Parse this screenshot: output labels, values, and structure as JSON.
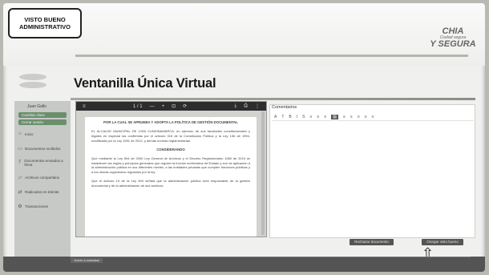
{
  "stamp": {
    "line1": "VISTO BUENO",
    "line2": "ADMINISTRATIVO"
  },
  "brand": {
    "right_top": "CHIA",
    "right_small": "Ciudad segura",
    "right_bottom": "Y SEGURA"
  },
  "page": {
    "title": "Ventanilla Única Virtual"
  },
  "sidebar": {
    "user": "Juan Gallo",
    "buttons": [
      "Cambiar clave",
      "Cerrar sesión"
    ],
    "items": [
      {
        "icon": "home-icon",
        "label": "Inicio"
      },
      {
        "icon": "document-icon",
        "label": "Documentos recibidos"
      },
      {
        "icon": "upload-icon",
        "label": "Documentos enviados a firma"
      },
      {
        "icon": "folder-icon",
        "label": "Archivos compartidos"
      },
      {
        "icon": "sync-icon",
        "label": "Radicados en trámite"
      },
      {
        "icon": "settings-icon",
        "label": "Transacciones"
      }
    ]
  },
  "viewer": {
    "menu_icon": "≡",
    "page_indicator": "1 / 1",
    "zoom_out": "—",
    "zoom_in": "+",
    "fit_icon": "⊡",
    "rotate_icon": "⟳",
    "download_icon": "⤓",
    "print_icon": "⎙",
    "more_icon": "⋮",
    "doc_heading": "POR LA CUAL SE APRUEBA Y ADOPTA LA POLÍTICA DE GESTIÓN DOCUMENTAL",
    "doc_para1": "EL ALCALDE MUNICIPAL DE CHÍA CUNDINAMARCA, en ejercicio de sus facultades constitucionales y legales en especial las conferidas por el artículo 315 de la Constitución Política y la Ley 136 de 1994, modificada por la Ley 1551 de 2012, y demás normas reglamentarias.",
    "doc_section": "CONSIDERANDO",
    "doc_para2": "Que mediante la Ley 594 de 2000 Ley General de Archivos y el Decreto Reglamentario 1080 de 2015 se establecen las reglas y principios generales que regulan la función archivística del Estado y son de aplicación a la administración pública en sus diferentes niveles, a las entidades privadas que cumplen funciones públicas y a los demás organismos regulados por la ley.",
    "doc_para3": "Que el artículo 19 de la Ley 594 señala que la administración pública será responsable de la gestión documental y de la administración de sus archivos."
  },
  "editor": {
    "label": "Comentarios",
    "toolbar": [
      "A",
      "T",
      "B",
      "I",
      "S",
      "≡",
      "≡",
      "≡",
      "▤",
      "≡",
      "≡",
      "≡",
      "≡",
      "≡"
    ]
  },
  "actions": {
    "reject": "Rechazar documento",
    "approve": "Otorgar visto bueno"
  },
  "footer": {
    "back": "Volver a consultar"
  }
}
